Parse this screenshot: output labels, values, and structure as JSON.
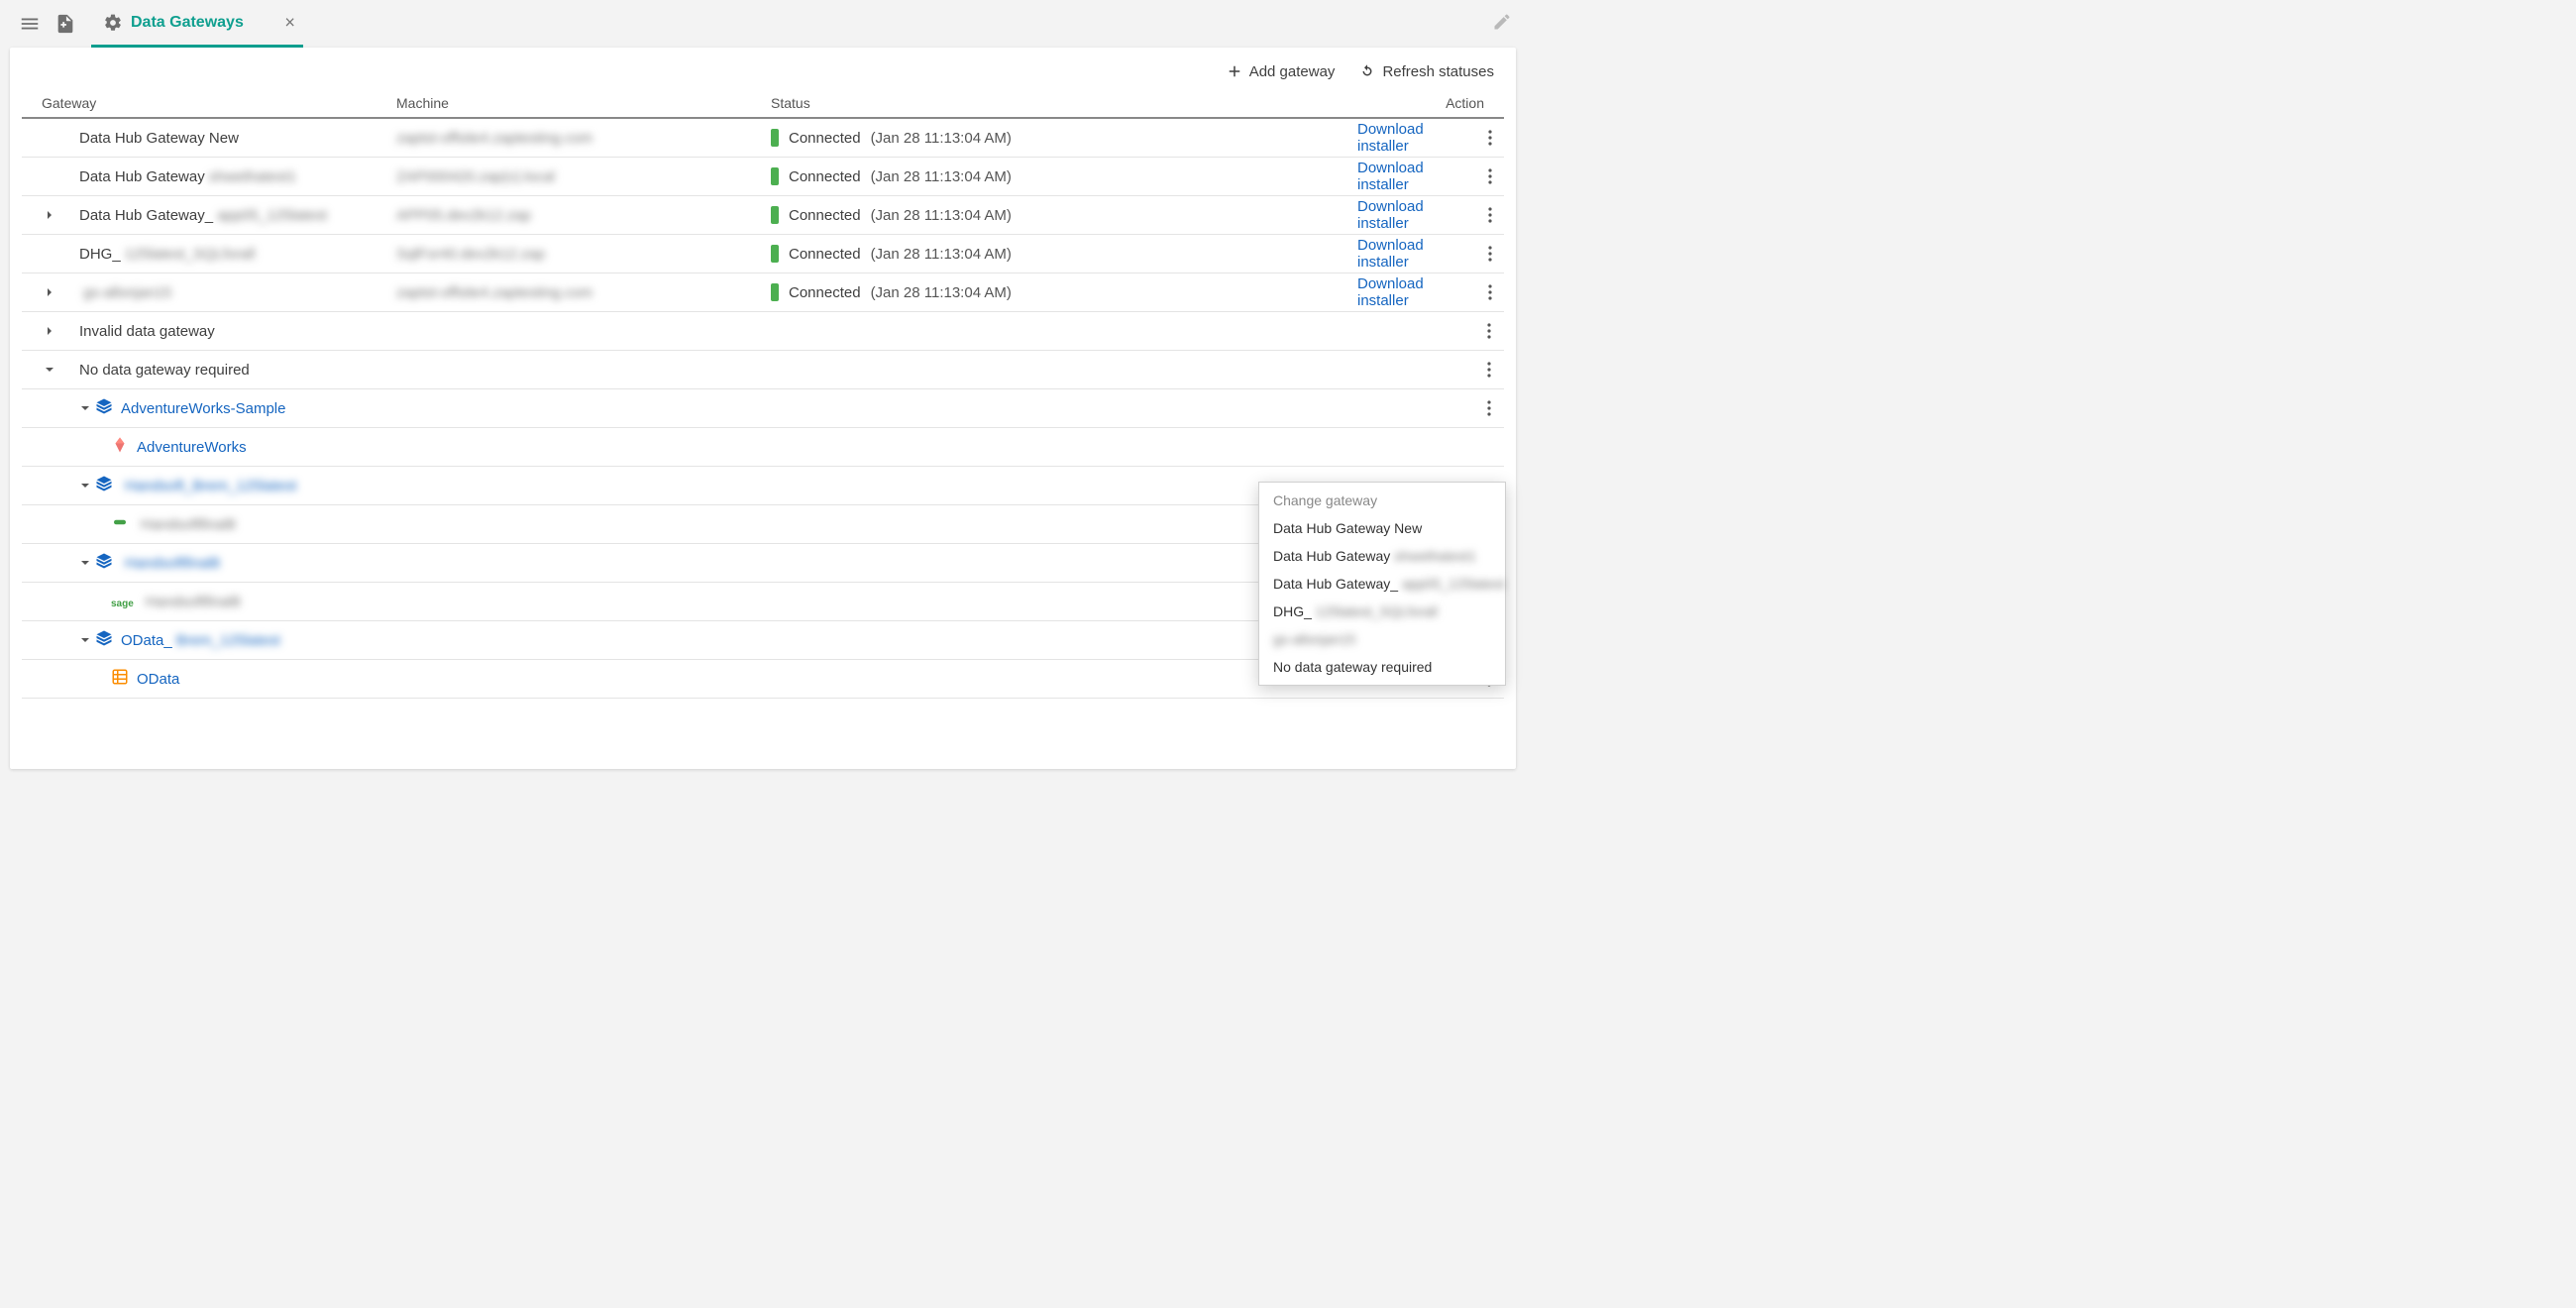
{
  "header": {
    "tab_label": "Data Gateways"
  },
  "toolbar": {
    "add_gateway": "Add gateway",
    "refresh_statuses": "Refresh statuses"
  },
  "table": {
    "headers": {
      "gateway": "Gateway",
      "machine": "Machine",
      "status": "Status",
      "action": "Action"
    },
    "download_label": "Download installer",
    "rows": [
      {
        "type": "gateway",
        "indent": 0,
        "expander": "none",
        "name": "Data Hub Gateway New",
        "name_blurred": "",
        "machine_blurred": "zaptst-offsite4.zaptesting.com",
        "status": "Connected",
        "status_time": "(Jan 28 11:13:04 AM)",
        "download": true,
        "kebab": true
      },
      {
        "type": "gateway",
        "indent": 0,
        "expander": "none",
        "name": "Data Hub Gateway",
        "name_blurred": "shwethatest1",
        "machine_blurred": "ZAP000420.zap(v).local",
        "status": "Connected",
        "status_time": "(Jan 28 11:13:04 AM)",
        "download": true,
        "kebab": true
      },
      {
        "type": "gateway",
        "indent": 0,
        "expander": "right",
        "name": "Data Hub Gateway_",
        "name_blurred": "app05_125latest",
        "machine_blurred": "APP05.dev2k12.zap",
        "status": "Connected",
        "status_time": "(Jan 28 11:13:04 AM)",
        "download": true,
        "kebab": true
      },
      {
        "type": "gateway",
        "indent": 0,
        "expander": "none",
        "name": "DHG_",
        "name_blurred": "125latest_SQLforall",
        "machine_blurred": "SqlFor40.dev2k12.zap",
        "status": "Connected",
        "status_time": "(Jan 28 11:13:04 AM)",
        "download": true,
        "kebab": true
      },
      {
        "type": "gateway",
        "indent": 0,
        "expander": "right",
        "name": "",
        "name_blurred": "gs-allonjan15",
        "machine_blurred": "zaptst-offsite4.zaptesting.com",
        "status": "Connected",
        "status_time": "(Jan 28 11:13:04 AM)",
        "download": true,
        "kebab": true
      },
      {
        "type": "group",
        "indent": 0,
        "expander": "right",
        "name": "Invalid data gateway",
        "kebab": true
      },
      {
        "type": "group",
        "indent": 0,
        "expander": "down",
        "name": "No data gateway required",
        "kebab": true
      },
      {
        "type": "datasource",
        "indent": 1,
        "expander": "down",
        "icon": "stack",
        "label": "AdventureWorks-Sample",
        "link": true,
        "kebab": true
      },
      {
        "type": "leaf",
        "indent": 3,
        "icon": "kite",
        "label": "AdventureWorks",
        "link": true,
        "kebab": false
      },
      {
        "type": "datasource",
        "indent": 1,
        "expander": "down",
        "icon": "stack",
        "label_blurred": "Handsoft_Brem_125latest",
        "link": true,
        "kebab": false
      },
      {
        "type": "leaf",
        "indent": 3,
        "icon": "tag-green",
        "label_blurred": "Handsoftfinal8",
        "link": false,
        "kebab": false
      },
      {
        "type": "datasource",
        "indent": 1,
        "expander": "down",
        "icon": "stack",
        "label_blurred": "Handsoftfinal8",
        "link": true,
        "kebab": false
      },
      {
        "type": "leaf",
        "indent": 3,
        "icon": "sage",
        "label_blurred": "Handsoftfinal8",
        "link": false,
        "kebab": false
      },
      {
        "type": "datasource",
        "indent": 1,
        "expander": "down",
        "icon": "stack",
        "label": "OData_",
        "label_blurred_suffix": "Brem_125latest",
        "link": true,
        "kebab": true
      },
      {
        "type": "leaf",
        "indent": 3,
        "icon": "grid-orange",
        "label": "OData",
        "link": true,
        "kebab": true
      }
    ]
  },
  "context_menu": {
    "title": "Change gateway",
    "items": [
      {
        "label": "Data Hub Gateway New"
      },
      {
        "label": "Data Hub Gateway",
        "blurred_suffix": "shwethatest1"
      },
      {
        "label": "Data Hub Gateway_",
        "blurred_suffix": "app05_125latest"
      },
      {
        "label": "DHG_",
        "blurred_suffix": "125latest_SQLforall"
      },
      {
        "blurred_suffix": "gs-allonjan15"
      },
      {
        "label": "No data gateway required"
      }
    ]
  }
}
